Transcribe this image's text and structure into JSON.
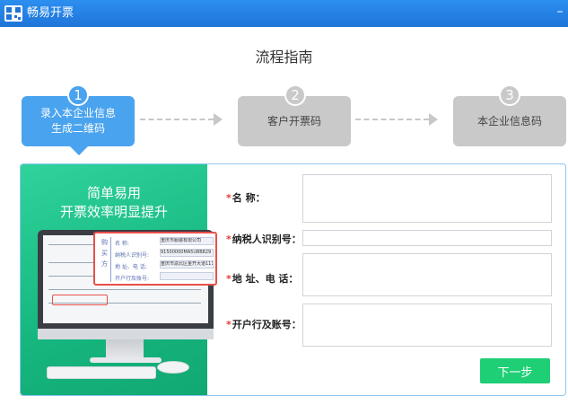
{
  "titlebar": {
    "app_title": "畅易开票",
    "minimize_label": "–"
  },
  "guide": {
    "title": "流程指南"
  },
  "steps": [
    {
      "number": "1",
      "line1": "录入本企业信息",
      "line2": "生成二维码",
      "state": "active"
    },
    {
      "number": "2",
      "line1": "客户开票码",
      "line2": "",
      "state": "inactive"
    },
    {
      "number": "3",
      "line1": "本企业信息码",
      "line2": "",
      "state": "inactive"
    }
  ],
  "promo": {
    "line1": "简单易用",
    "line2": "开票效率明显提升"
  },
  "illustration": {
    "side_text": "购买方",
    "rows": [
      {
        "label": "名        称:",
        "value": "重庆市服装有限公司"
      },
      {
        "label": "纳税人识别号:",
        "value": "91500000MA5U8B829"
      },
      {
        "label": "地 址、电 话:",
        "value": "重庆市渝北区金开大道1111号"
      },
      {
        "label": "开户行及账号:",
        "value": ""
      }
    ]
  },
  "form": {
    "required_mark": "*",
    "name_label": "名        称：",
    "taxid_label": "纳税人识别号：",
    "address_label": "地 址、电 话：",
    "bank_label": "开户行及账号：",
    "name_value": "",
    "taxid_value": "",
    "address_value": "",
    "bank_value": ""
  },
  "actions": {
    "next_label": "下一步"
  },
  "colors": {
    "accent": "#4aa3ee",
    "promo_green": "#16b67f",
    "button_green": "#1fcf76",
    "required_red": "#e53935"
  }
}
